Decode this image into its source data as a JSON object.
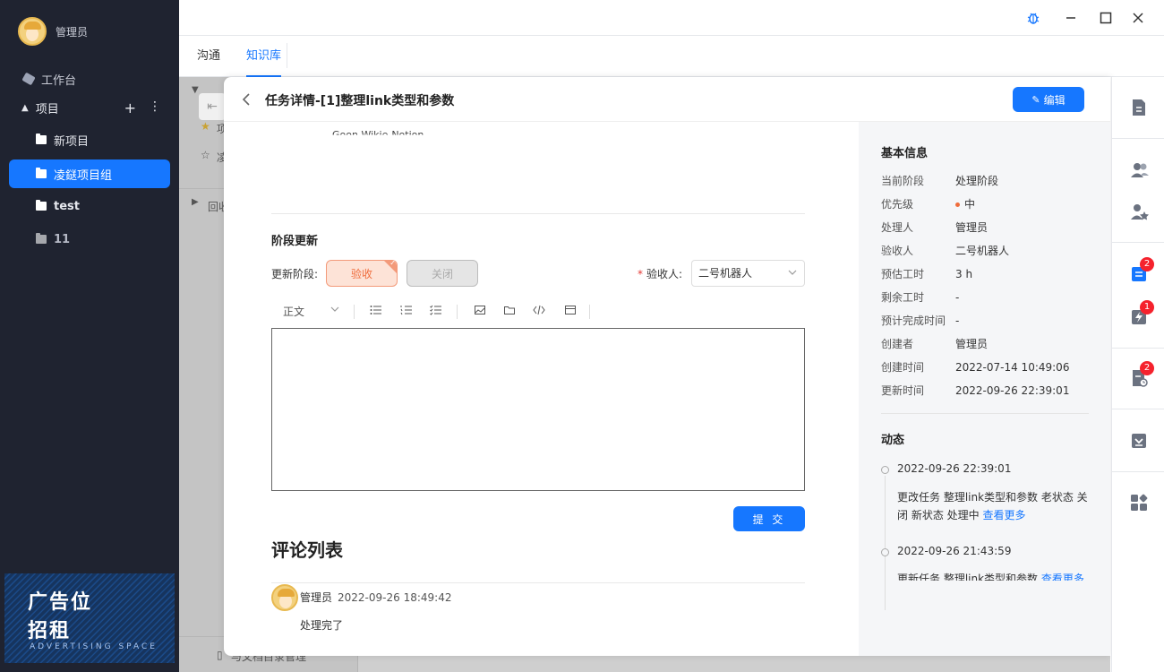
{
  "user": {
    "name": "管理员"
  },
  "sidebar": {
    "workbench": "工作台",
    "projects_label": "项目",
    "items": [
      {
        "label": "新项目"
      },
      {
        "label": "凌鎹项目组"
      },
      {
        "label": "test"
      },
      {
        "label": "11"
      }
    ]
  },
  "ad": {
    "line1": "广告位",
    "line2": "招租",
    "sub": "ADVERTISING SPACE"
  },
  "tabs": [
    {
      "label": "沟通"
    },
    {
      "label": "知识库"
    }
  ],
  "background": {
    "b1": "项",
    "b2": "凌",
    "b3": "回收",
    "b4": "与文档目录管理"
  },
  "task": {
    "title": "任务详情-[1]整理link类型和参数",
    "edit_label": "编辑",
    "top_cut": "Goon-Wikie-Notion",
    "stage_section": "阶段更新",
    "stage_label": "更新阶段:",
    "stage_accept": "验收",
    "stage_close": "关闭",
    "acceptor_label": "验收人:",
    "acceptor_value": "二号机器人",
    "toolbar_format": "正文",
    "submit_label": "提 交",
    "comments_title": "评论列表",
    "comment": {
      "author": "管理员",
      "time": "2022-09-26 18:49:42",
      "body": "处理完了"
    }
  },
  "info": {
    "title": "基本信息",
    "rows": [
      {
        "k": "当前阶段",
        "v": "处理阶段"
      },
      {
        "k": "优先级",
        "v": "中"
      },
      {
        "k": "处理人",
        "v": "管理员"
      },
      {
        "k": "验收人",
        "v": "二号机器人"
      },
      {
        "k": "预估工时",
        "v": "3 h"
      },
      {
        "k": "剩余工时",
        "v": "-"
      },
      {
        "k": "预计完成时间",
        "v": "-"
      },
      {
        "k": "创建者",
        "v": "管理员"
      },
      {
        "k": "创建时间",
        "v": "2022-07-14 10:49:06"
      },
      {
        "k": "更新时间",
        "v": "2022-09-26 22:39:01"
      }
    ],
    "dynamics_title": "动态",
    "events": [
      {
        "time": "2022-09-26 22:39:01",
        "text": "更改任务 整理link类型和参数 老状态 关闭 新状态 处理中",
        "link": "查看更多"
      },
      {
        "time": "2022-09-26 21:43:59",
        "text": "更新任务 整理link类型和参数",
        "link": "查看更多"
      }
    ]
  },
  "rail": {
    "badges": [
      "2",
      "1",
      "2"
    ]
  },
  "colors": {
    "accent": "#1677ff",
    "sidebar_bg": "#1f2330",
    "warning": "#ef6c3c",
    "badge": "#f5222d"
  }
}
